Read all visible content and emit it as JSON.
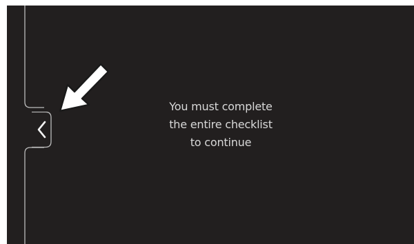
{
  "message": {
    "line1": "You must complete",
    "line2": "the entire checklist",
    "line3": "to continue"
  },
  "back_tab": {
    "icon": "chevron-left-icon"
  },
  "annotation": {
    "icon": "pointer-arrow-icon",
    "color": "#ffffff"
  },
  "colors": {
    "background": "#221f1f",
    "outline": "#bdbdbd",
    "text": "#d8d8d8"
  }
}
